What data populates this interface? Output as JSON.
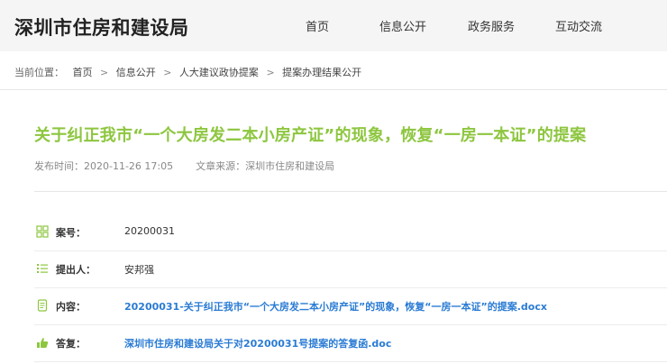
{
  "header": {
    "site_title": "深圳市住房和建设局",
    "nav": [
      "首页",
      "信息公开",
      "政务服务",
      "互动交流"
    ]
  },
  "breadcrumb": {
    "lead": "当前位置：",
    "items": [
      "首页",
      "信息公开",
      "人大建议政协提案",
      "提案办理结果公开"
    ],
    "separator": ">"
  },
  "article": {
    "title": "关于纠正我市“一个大房发二本小房产证”的现象，恢复“一房一本证”的提案",
    "publish_label": "发布时间：",
    "publish_time": "2020-11-26 17:05",
    "source_label": "文章来源：",
    "source": "深圳市住房和建设局"
  },
  "details": {
    "case_no_label": "案号：",
    "case_no": "20200031",
    "proposer_label": "提出人：",
    "proposer": "安邦强",
    "content_label": "内容：",
    "content_link": "20200031-关于纠正我市“一个大房发二本小房产证”的现象，恢复“一房一本证”的提案.docx",
    "reply_label": "答复：",
    "reply_link": "深圳市住房和建设局关于对20200031号提案的答复函.doc"
  },
  "colors": {
    "title_green": "#8dc63f",
    "link_blue": "#2a7bd4",
    "header_bg": "#f5f5f5"
  }
}
